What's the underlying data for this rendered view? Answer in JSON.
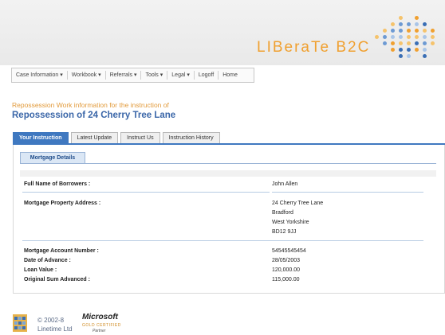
{
  "header": {
    "brand_main": "LIBeraTe",
    "brand_sub": "B2C"
  },
  "nav": {
    "items": [
      {
        "label": "Case Information ▾"
      },
      {
        "label": "Workbook ▾"
      },
      {
        "label": "Referrals ▾"
      },
      {
        "label": "Tools ▾"
      },
      {
        "label": "Legal ▾"
      },
      {
        "label": "Logoff"
      },
      {
        "label": "Home"
      }
    ]
  },
  "heading": {
    "subtitle": "Repossession Work information for the instruction of",
    "title": "Repossession of 24 Cherry Tree Lane"
  },
  "tabs": [
    "Your Instruction",
    "Latest Update",
    "Instruct Us",
    "Instruction History"
  ],
  "panel": {
    "subtab": "Mortgage Details",
    "borrowers_label": "Full Name of Borrowers :",
    "borrowers_value": "John Allen",
    "address_label": "Mortgage Property Address :",
    "address_lines": [
      "24 Cherry Tree Lane",
      "Bradford",
      "West Yorkshire",
      "BD12 9JJ"
    ],
    "account_label": "Mortgage Account Number :",
    "account_value": "54545545454",
    "advance_label": "Date of Advance :",
    "advance_value": "28/05/2003",
    "loan_label": "Loan Value :",
    "loan_value": "120,000.00",
    "original_label": "Original Sum Advanced :",
    "original_value": "115,000.00"
  },
  "footer": {
    "copyright": "© 2002-8",
    "company": "Linetime Ltd",
    "ms_brand": "Microsoft",
    "ms_cert": "GOLD CERTIFIED",
    "ms_partner": "Partner"
  },
  "colors": {
    "accent": "#3f78c0",
    "brand_orange": "#f0a030",
    "title_blue": "#3a66a8"
  }
}
